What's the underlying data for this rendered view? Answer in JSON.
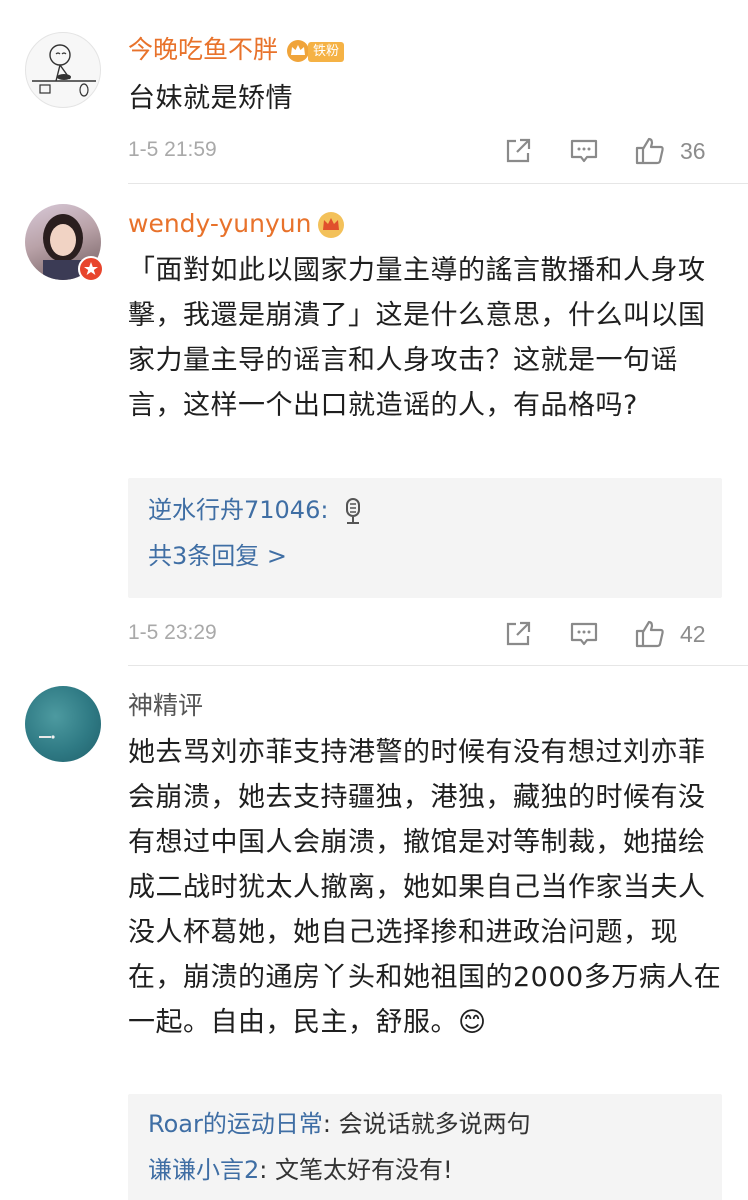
{
  "comments": [
    {
      "username": "今晚吃鱼不胖",
      "badge": "铁粉",
      "text": "台妹就是矫情",
      "time": "1-5 21:59",
      "likes": "36"
    },
    {
      "username": "wendy-yunyun",
      "text": "「面對如此以國家力量主導的謠言散播和人身攻擊，我還是崩潰了」这是什么意思，什么叫以国家力量主导的谣言和人身攻击？这就是一句谣言，这样一个出口就造谣的人，有品格吗?",
      "replies": [
        {
          "name": "逆水行舟71046",
          "sep": ":",
          "text": ""
        }
      ],
      "more_replies": "共3条回复 >",
      "time": "1-5 23:29",
      "likes": "42"
    },
    {
      "username": "神精评",
      "text": "她去骂刘亦菲支持港警的时候有没有想过刘亦菲会崩溃，她去支持疆独，港独，藏独的时候有没有想过中国人会崩溃，撤馆是对等制裁，她描绘成二战时犹太人撤离，她如果自己当作家当夫人没人杯葛她，她自己选择掺和进政治问题，现在，崩溃的通房丫头和她祖国的2000多万病人在一起。自由，民主，舒服。😊",
      "replies": [
        {
          "name": "Roar的运动日常",
          "sep": ": ",
          "text": "会说话就多说两句"
        },
        {
          "name": "谦谦小言2",
          "sep": ": ",
          "text": "文笔太好有没有!"
        }
      ]
    }
  ],
  "icons": {
    "share": "share-icon",
    "comment": "comment-icon",
    "like": "thumbs-up-icon",
    "crown": "crown-icon",
    "voice": "microphone-icon"
  },
  "colors": {
    "username_orange": "#e8722b",
    "reply_link_blue": "#3f6ea4",
    "timestamp_gray": "#a9a9a9",
    "reply_bg": "#f4f4f4"
  }
}
